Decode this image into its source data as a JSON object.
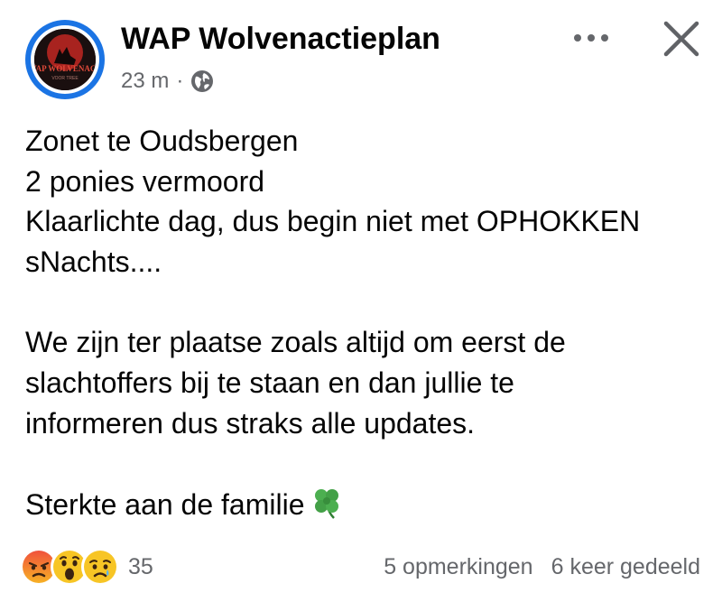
{
  "post": {
    "page_name": "WAP Wolvenactieplan",
    "timestamp": "23 m",
    "separator": "·",
    "audience_icon": "globe-icon",
    "avatar_text": "WAP WOLVENACT",
    "avatar_subtext": "VOOR TREE",
    "body_lines": [
      "Zonet te Oudsbergen",
      "2 ponies vermoord",
      "Klaarlichte dag, dus begin niet met OPHOKKEN",
      "sNachts....",
      "",
      "We zijn ter plaatse zoals altijd om eerst de",
      "slachtoffers bij te staan en dan jullie te",
      "informeren dus straks alle updates.",
      "",
      "Sterkte aan de familie"
    ],
    "emoji": "four-leaf-clover"
  },
  "footer": {
    "reaction_icons": [
      "angry-reaction-icon",
      "wow-reaction-icon",
      "sad-reaction-icon"
    ],
    "reaction_count": "35",
    "comments": "5 opmerkingen",
    "shares": "6 keer gedeeld"
  },
  "colors": {
    "accent": "#1b74e4",
    "text": "#050505",
    "secondary": "#65676b"
  }
}
